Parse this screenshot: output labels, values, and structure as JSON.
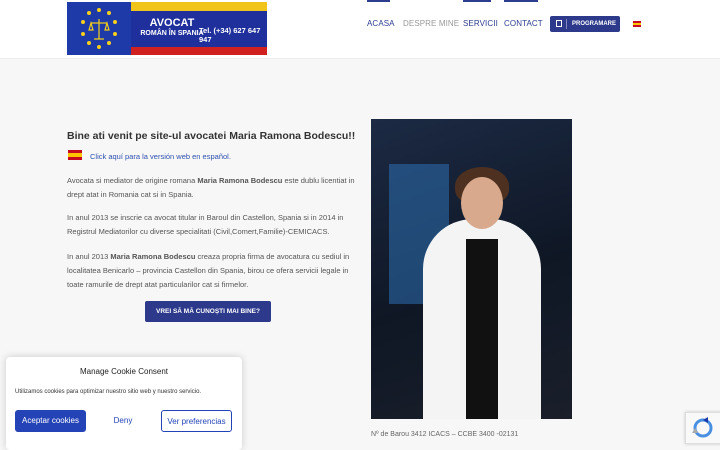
{
  "header": {
    "logo": {
      "title": "AVOCAT",
      "subtitle": "ROMÂN ÎN SPANIA",
      "phone": "Tel. (+34) 627 647 947"
    },
    "nav": [
      {
        "label": "ACASA",
        "active": true
      },
      {
        "label": "DESPRE MINE",
        "active": false
      },
      {
        "label": "SERVICII",
        "active": true
      },
      {
        "label": "CONTACT",
        "active": true
      }
    ],
    "program_button": "PROGRAMARE",
    "program_icon": "calendar-icon",
    "language_icon": "spain-flag-icon"
  },
  "main": {
    "heading": "Bine ati venit pe site-ul avocatei Maria Ramona Bodescu!!",
    "es_link": "Click aquí para la versión web en español.",
    "p1": {
      "before": "Avocata si mediator de origine romana ",
      "bold": "Maria Ramona Bodescu",
      "after": " este dublu licentiat in drept atat in Romania cat si in Spania."
    },
    "p2": "In anul 2013 se inscrie ca avocat titular in Baroul din Castellon, Spania si in 2014 in Registrul Mediatorilor cu diverse specialitati (Civil,Comert,Familie)-CEMICACS.",
    "p3": {
      "before": "In anul 2013 ",
      "bold": "Maria Ramona Bodescu",
      "after": " creaza propria firma de avocatura cu sediul in localitatea Benicarlo – provincia Castellon din Spania, birou ce ofera servicii legale in toate ramurile de drept atat particularilor cat si firmelor."
    },
    "cta": "VREI SĂ MĂ CUNOȘTI MAI BINE?",
    "caption": "Nº de Barou 3412 ICACS – CCBE 3400 -02131"
  },
  "cookie": {
    "title": "Manage Cookie Consent",
    "text": "Utilizamos cookies para optimizar nuestro sitio web y nuestro servicio.",
    "accept": "Aceptar cookies",
    "deny": "Deny",
    "prefs": "Ver preferencias"
  },
  "colors": {
    "brand": "#2d3a8c",
    "link": "#2d4fb0",
    "cookie_accent": "#2343b7"
  }
}
